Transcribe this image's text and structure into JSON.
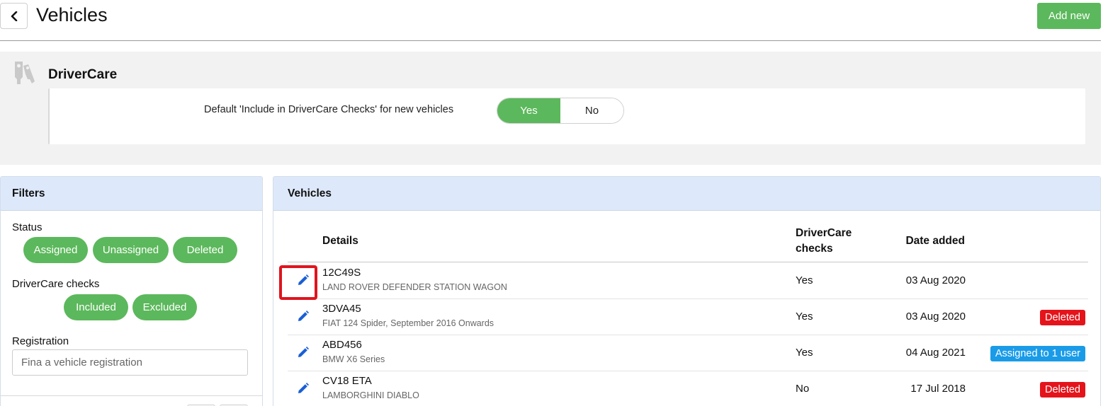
{
  "header": {
    "title": "Vehicles",
    "add_label": "Add new"
  },
  "drivercare": {
    "title": "DriverCare",
    "default_label": "Default 'Include in DriverCare Checks' for new vehicles",
    "yes_label": "Yes",
    "no_label": "No",
    "selected": "Yes"
  },
  "filters": {
    "title": "Filters",
    "status_label": "Status",
    "status_options": [
      "Assigned",
      "Unassigned",
      "Deleted"
    ],
    "checks_label": "DriverCare checks",
    "checks_options": [
      "Included",
      "Excluded"
    ],
    "registration_label": "Registration",
    "registration_placeholder": "Fina a vehicle registration",
    "registration_value": ""
  },
  "vehicles": {
    "title": "Vehicles",
    "columns": {
      "details": "Details",
      "drivercare_line1": "DriverCare",
      "drivercare_line2": "checks",
      "date_added": "Date added"
    },
    "rows": [
      {
        "registration": "12C49S",
        "model": "LAND ROVER DEFENDER STATION WAGON",
        "drivercare": "Yes",
        "date": "03 Aug 2020",
        "badge": ""
      },
      {
        "registration": "3DVA45",
        "model": "FIAT 124 Spider, September 2016 Onwards",
        "drivercare": "Yes",
        "date": "03 Aug 2020",
        "badge": "Deleted"
      },
      {
        "registration": "ABD456",
        "model": "BMW X6 Series",
        "drivercare": "Yes",
        "date": "04 Aug 2021",
        "badge": "Assigned to 1 user"
      },
      {
        "registration": "CV18 ETA",
        "model": "LAMBORGHINI DIABLO",
        "drivercare": "No",
        "date": "17 Jul 2018",
        "badge": "Deleted"
      }
    ]
  },
  "colors": {
    "accent_green": "#5cb85c",
    "panel_header": "#dde9fb",
    "badge_deleted": "#e5141b",
    "badge_assigned": "#1a9be8",
    "edit_icon": "#1a5fd4",
    "highlight": "#e0141e"
  },
  "icons": {
    "back": "chevron-left-icon",
    "drivercare": "keys-icon",
    "edit": "pencil-icon"
  }
}
